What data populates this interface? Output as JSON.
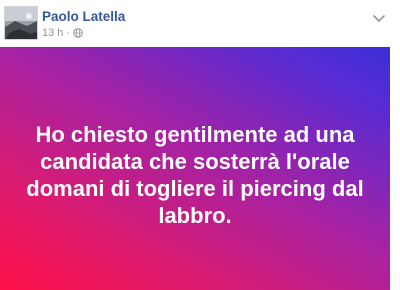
{
  "post": {
    "author": "Paolo Latella",
    "time": "13 h",
    "separator": "·",
    "privacy_icon": "globe-icon",
    "menu_icon": "chevron-down-icon",
    "text": "Ho chiesto gentilmente ad una candidata che sosterrà l'orale domani di togliere il piercing dal labbro."
  },
  "colors": {
    "author_link": "#365899",
    "meta_text": "#90949c",
    "gradient_start": "#ff1148",
    "gradient_mid": "#a522a4",
    "gradient_end": "#3a2fd8",
    "post_text": "#ffffff"
  }
}
